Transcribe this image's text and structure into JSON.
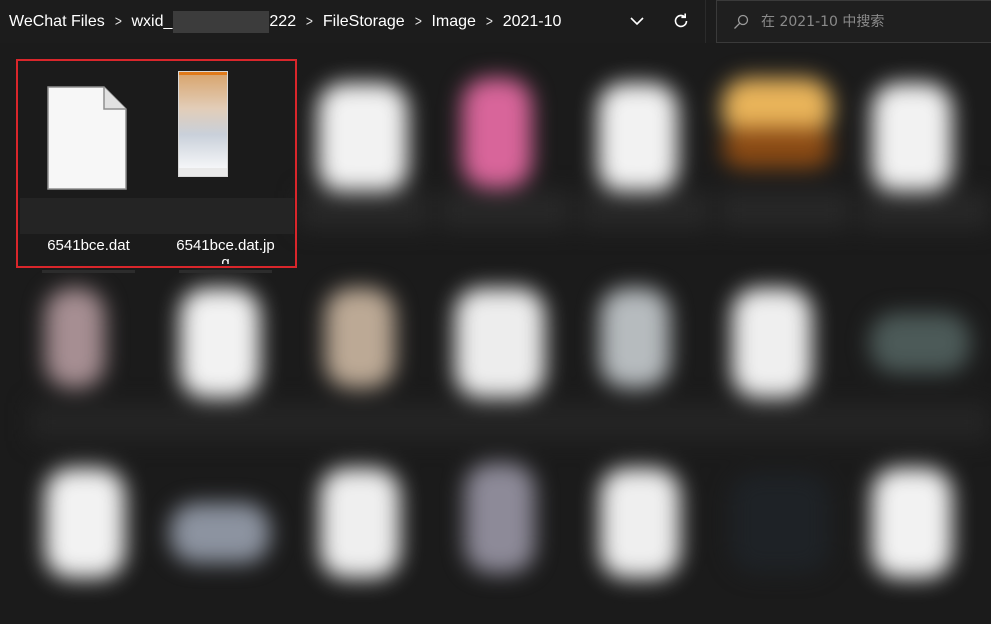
{
  "breadcrumb": {
    "items": [
      {
        "label": "WeChat Files"
      },
      {
        "label_prefix": "wxid_",
        "label_suffix": "222"
      },
      {
        "label": "FileStorage"
      },
      {
        "label": "Image"
      },
      {
        "label": "2021-10"
      }
    ],
    "separator": ">"
  },
  "toolbar": {
    "dropdown_icon": "chevron-down-icon",
    "refresh_icon": "refresh-icon"
  },
  "search": {
    "placeholder": "在 2021-10 中搜索",
    "icon": "search-icon"
  },
  "files": [
    {
      "name": "6541bce.dat",
      "type": "file",
      "icon": "document-icon"
    },
    {
      "name_line1": "6541bce.dat.jp",
      "name_line2": "g",
      "type": "image",
      "icon": "image-thumbnail"
    }
  ],
  "colors": {
    "background": "#191919",
    "highlight": "#d9262b",
    "thumbnail_accent": "#e07a1a"
  }
}
